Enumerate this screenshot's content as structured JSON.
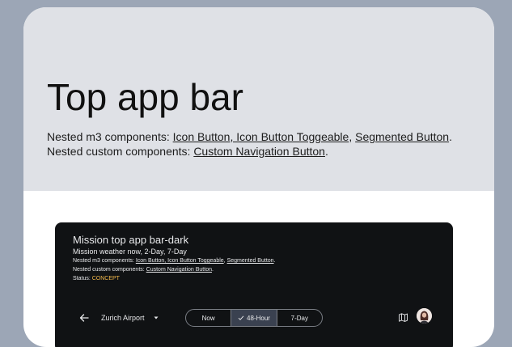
{
  "hero": {
    "title": "Top app bar",
    "nested_m3_prefix": "Nested m3 components: ",
    "nested_m3_links": [
      "Icon Button, Icon Button Toggeable",
      "Segmented Button"
    ],
    "nested_custom_prefix": "Nested custom components: ",
    "nested_custom_link": "Custom Navigation Button"
  },
  "demo": {
    "title": "Mission top app bar-dark",
    "subtitle": "Mission weather now, 2-Day, 7-Day",
    "nested_m3_prefix": "Nested m3 components: ",
    "nested_m3_links": [
      "Icon Button, Icon Button Toggeable",
      "Segmented Button"
    ],
    "nested_custom_prefix": "Nested custom components: ",
    "nested_custom_link": "Custom Navigation Button",
    "status_label": "Status: ",
    "status_value": "CONCEPT",
    "status_color": "#f2b84b"
  },
  "appbar": {
    "back_icon": "arrow-back-icon",
    "location": "Zurich Airport",
    "location_dropdown_icon": "caret-down-icon",
    "segments": [
      {
        "label": "Now",
        "selected": false
      },
      {
        "label": "48-Hour",
        "selected": true
      },
      {
        "label": "7-Day",
        "selected": false
      }
    ],
    "map_icon": "map-icon",
    "avatar_icon": "user-avatar"
  },
  "colors": {
    "background": "#9ca6b6",
    "hero_bg": "#dfe1e6",
    "demo_bg": "#101214",
    "segment_selected": "#3a4150"
  }
}
